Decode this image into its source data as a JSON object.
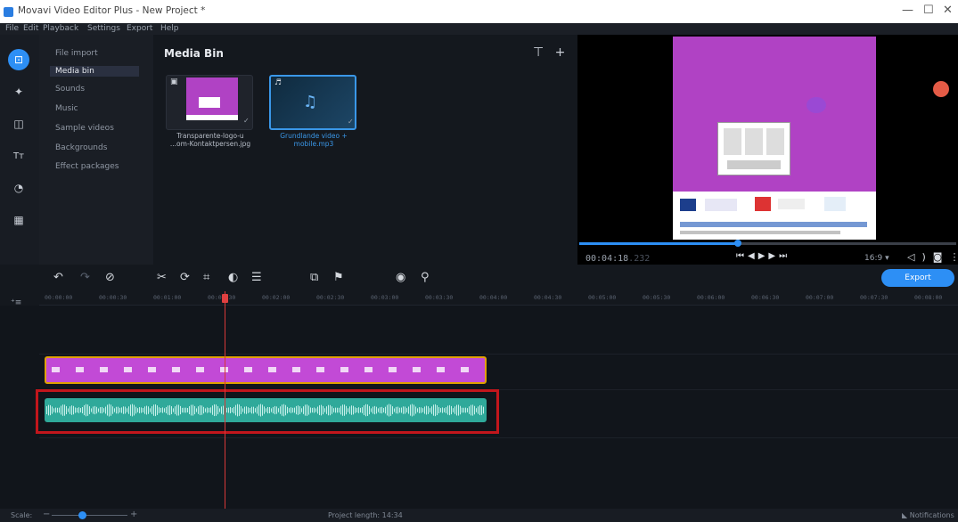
{
  "window": {
    "title": "Movavi Video Editor Plus - New Project *",
    "controls": [
      "—",
      "☐",
      "✕"
    ]
  },
  "menu": [
    "File",
    "Edit",
    "Playback",
    "Settings",
    "Export",
    "Help"
  ],
  "leftbar": {
    "icons": [
      "import-icon",
      "wand-icon",
      "transition-icon",
      "titles-icon",
      "stickers-icon",
      "more-tools-icon"
    ]
  },
  "categories": [
    {
      "label": "File import",
      "active": false
    },
    {
      "label": "Media bin",
      "active": true
    },
    {
      "label": "Sounds",
      "active": false
    },
    {
      "label": "Music",
      "active": false
    },
    {
      "label": "Sample videos",
      "active": false
    },
    {
      "label": "Backgrounds",
      "active": false
    },
    {
      "label": "Effect packages",
      "active": false
    }
  ],
  "media_bin": {
    "title": "Media Bin",
    "items": [
      {
        "caption_line1": "Transparente-logo-u",
        "caption_line2": "...om-Kontaktpersen.jpg",
        "type": "image"
      },
      {
        "caption_line1": "Grundlande video +",
        "caption_line2": "mobile.mp3",
        "type": "audio"
      }
    ]
  },
  "preview": {
    "time_current": "00:04:18",
    "time_suffix": ".232",
    "aspect_ratio": "16:9 ▾",
    "progress": 0.42
  },
  "toolbar": {
    "export_label": "Export"
  },
  "ruler": {
    "ticks": [
      "00:00:00",
      "00:00:30",
      "00:01:00",
      "00:01:30",
      "00:02:00",
      "00:02:30",
      "00:03:00",
      "00:03:30",
      "00:04:00",
      "00:04:30",
      "00:05:00",
      "00:05:30",
      "00:06:00",
      "00:06:30",
      "00:07:00",
      "00:07:30",
      "00:08:00"
    ]
  },
  "status": {
    "scale_label": "Scale:",
    "scale_level": 0.4,
    "project_length": "Project length: 14:34",
    "notifications": "Notifications"
  },
  "colors": {
    "accent": "#2d8ff5",
    "video_clip": "#c24ad6",
    "audio_clip": "#2fa99a",
    "highlight": "#c2161c"
  }
}
